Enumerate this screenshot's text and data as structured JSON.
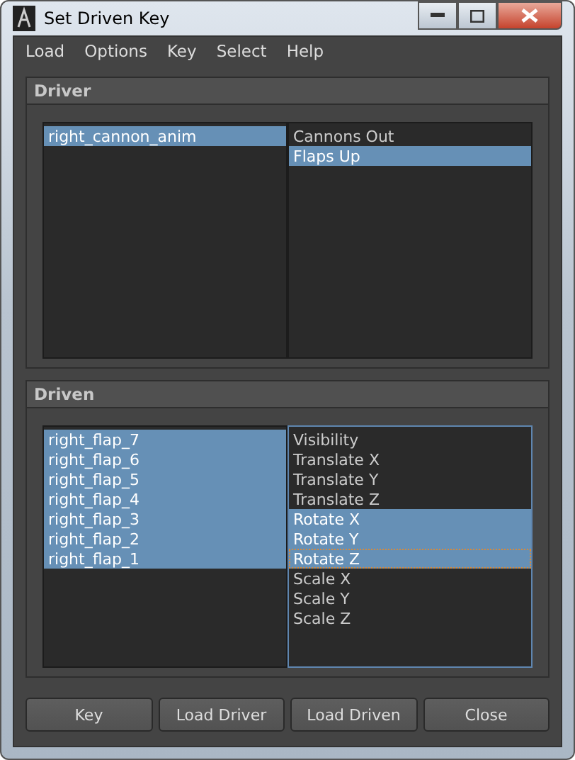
{
  "window": {
    "title": "Set Driven Key"
  },
  "menu": [
    "Load",
    "Options",
    "Key",
    "Select",
    "Help"
  ],
  "sections": [
    {
      "title": "Driver",
      "lists": [
        {
          "focused": false,
          "items": [
            {
              "label": "right_cannon_anim",
              "selected": true,
              "focused": false
            }
          ]
        },
        {
          "focused": false,
          "items": [
            {
              "label": "Cannons Out",
              "selected": false,
              "focused": false
            },
            {
              "label": "Flaps Up",
              "selected": true,
              "focused": false
            }
          ]
        }
      ]
    },
    {
      "title": "Driven",
      "lists": [
        {
          "focused": false,
          "items": [
            {
              "label": "right_flap_7",
              "selected": true,
              "focused": false
            },
            {
              "label": "right_flap_6",
              "selected": true,
              "focused": false
            },
            {
              "label": "right_flap_5",
              "selected": true,
              "focused": false
            },
            {
              "label": "right_flap_4",
              "selected": true,
              "focused": false
            },
            {
              "label": "right_flap_3",
              "selected": true,
              "focused": false
            },
            {
              "label": "right_flap_2",
              "selected": true,
              "focused": false
            },
            {
              "label": "right_flap_1",
              "selected": true,
              "focused": false
            }
          ]
        },
        {
          "focused": true,
          "items": [
            {
              "label": "Visibility",
              "selected": false,
              "focused": false
            },
            {
              "label": "Translate X",
              "selected": false,
              "focused": false
            },
            {
              "label": "Translate Y",
              "selected": false,
              "focused": false
            },
            {
              "label": "Translate Z",
              "selected": false,
              "focused": false
            },
            {
              "label": "Rotate X",
              "selected": true,
              "focused": false
            },
            {
              "label": "Rotate Y",
              "selected": true,
              "focused": false
            },
            {
              "label": "Rotate Z",
              "selected": true,
              "focused": true
            },
            {
              "label": "Scale X",
              "selected": false,
              "focused": false
            },
            {
              "label": "Scale Y",
              "selected": false,
              "focused": false
            },
            {
              "label": "Scale Z",
              "selected": false,
              "focused": false
            }
          ]
        }
      ]
    }
  ],
  "buttons": [
    "Key",
    "Load Driver",
    "Load Driven",
    "Close"
  ]
}
